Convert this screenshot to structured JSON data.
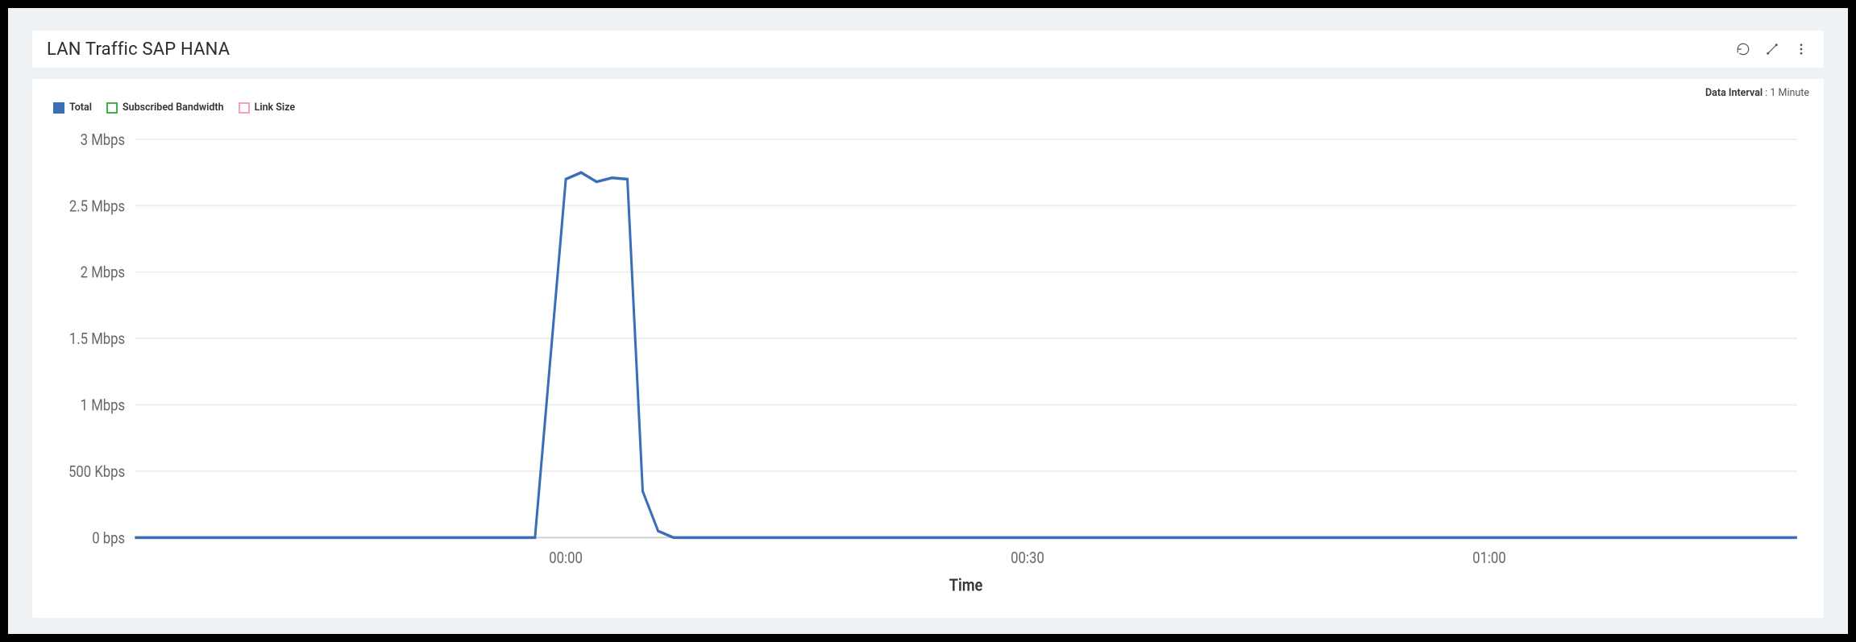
{
  "header": {
    "title": "LAN Traffic SAP HANA"
  },
  "data_interval": {
    "label": "Data Interval",
    "value": "1 Minute"
  },
  "legend": [
    {
      "label": "Total",
      "color": "#3a6fb7",
      "filled": true
    },
    {
      "label": "Subscribed Bandwidth",
      "color": "#3fb24f",
      "filled": false
    },
    {
      "label": "Link Size",
      "color": "#f49fc6",
      "filled": false
    }
  ],
  "chart_data": {
    "type": "line",
    "title": "LAN Traffic SAP HANA",
    "xlabel": "Time",
    "ylabel": "",
    "y_ticks": [
      {
        "v": 0,
        "label": "0 bps"
      },
      {
        "v": 500000,
        "label": "500 Kbps"
      },
      {
        "v": 1000000,
        "label": "1 Mbps"
      },
      {
        "v": 1500000,
        "label": "1.5 Mbps"
      },
      {
        "v": 2000000,
        "label": "2 Mbps"
      },
      {
        "v": 2500000,
        "label": "2.5 Mbps"
      },
      {
        "v": 3000000,
        "label": "3 Mbps"
      }
    ],
    "x_range_minutes": [
      -28,
      80
    ],
    "x_ticks": [
      {
        "m": 0,
        "label": "00:00"
      },
      {
        "m": 30,
        "label": "00:30"
      },
      {
        "m": 60,
        "label": "01:00"
      }
    ],
    "ylim": [
      0,
      3000000
    ],
    "series": [
      {
        "name": "Total",
        "color": "#3a6fb7",
        "points": [
          {
            "m": -28,
            "v": 0
          },
          {
            "m": -2,
            "v": 0
          },
          {
            "m": 0,
            "v": 2700000
          },
          {
            "m": 1,
            "v": 2750000
          },
          {
            "m": 2,
            "v": 2680000
          },
          {
            "m": 3,
            "v": 2710000
          },
          {
            "m": 4,
            "v": 2700000
          },
          {
            "m": 5,
            "v": 350000
          },
          {
            "m": 6,
            "v": 50000
          },
          {
            "m": 7,
            "v": 0
          },
          {
            "m": 80,
            "v": 0
          }
        ]
      },
      {
        "name": "Subscribed Bandwidth",
        "color": "#3fb24f",
        "points": []
      },
      {
        "name": "Link Size",
        "color": "#f49fc6",
        "points": []
      }
    ]
  }
}
